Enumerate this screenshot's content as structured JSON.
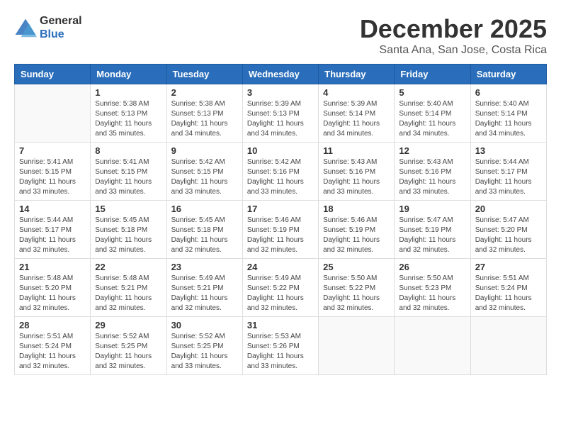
{
  "logo": {
    "general": "General",
    "blue": "Blue"
  },
  "title": "December 2025",
  "location": "Santa Ana, San Jose, Costa Rica",
  "weekdays": [
    "Sunday",
    "Monday",
    "Tuesday",
    "Wednesday",
    "Thursday",
    "Friday",
    "Saturday"
  ],
  "weeks": [
    [
      {
        "day": "",
        "info": ""
      },
      {
        "day": "1",
        "info": "Sunrise: 5:38 AM\nSunset: 5:13 PM\nDaylight: 11 hours\nand 35 minutes."
      },
      {
        "day": "2",
        "info": "Sunrise: 5:38 AM\nSunset: 5:13 PM\nDaylight: 11 hours\nand 34 minutes."
      },
      {
        "day": "3",
        "info": "Sunrise: 5:39 AM\nSunset: 5:13 PM\nDaylight: 11 hours\nand 34 minutes."
      },
      {
        "day": "4",
        "info": "Sunrise: 5:39 AM\nSunset: 5:14 PM\nDaylight: 11 hours\nand 34 minutes."
      },
      {
        "day": "5",
        "info": "Sunrise: 5:40 AM\nSunset: 5:14 PM\nDaylight: 11 hours\nand 34 minutes."
      },
      {
        "day": "6",
        "info": "Sunrise: 5:40 AM\nSunset: 5:14 PM\nDaylight: 11 hours\nand 34 minutes."
      }
    ],
    [
      {
        "day": "7",
        "info": "Sunrise: 5:41 AM\nSunset: 5:15 PM\nDaylight: 11 hours\nand 33 minutes."
      },
      {
        "day": "8",
        "info": "Sunrise: 5:41 AM\nSunset: 5:15 PM\nDaylight: 11 hours\nand 33 minutes."
      },
      {
        "day": "9",
        "info": "Sunrise: 5:42 AM\nSunset: 5:15 PM\nDaylight: 11 hours\nand 33 minutes."
      },
      {
        "day": "10",
        "info": "Sunrise: 5:42 AM\nSunset: 5:16 PM\nDaylight: 11 hours\nand 33 minutes."
      },
      {
        "day": "11",
        "info": "Sunrise: 5:43 AM\nSunset: 5:16 PM\nDaylight: 11 hours\nand 33 minutes."
      },
      {
        "day": "12",
        "info": "Sunrise: 5:43 AM\nSunset: 5:16 PM\nDaylight: 11 hours\nand 33 minutes."
      },
      {
        "day": "13",
        "info": "Sunrise: 5:44 AM\nSunset: 5:17 PM\nDaylight: 11 hours\nand 33 minutes."
      }
    ],
    [
      {
        "day": "14",
        "info": "Sunrise: 5:44 AM\nSunset: 5:17 PM\nDaylight: 11 hours\nand 32 minutes."
      },
      {
        "day": "15",
        "info": "Sunrise: 5:45 AM\nSunset: 5:18 PM\nDaylight: 11 hours\nand 32 minutes."
      },
      {
        "day": "16",
        "info": "Sunrise: 5:45 AM\nSunset: 5:18 PM\nDaylight: 11 hours\nand 32 minutes."
      },
      {
        "day": "17",
        "info": "Sunrise: 5:46 AM\nSunset: 5:19 PM\nDaylight: 11 hours\nand 32 minutes."
      },
      {
        "day": "18",
        "info": "Sunrise: 5:46 AM\nSunset: 5:19 PM\nDaylight: 11 hours\nand 32 minutes."
      },
      {
        "day": "19",
        "info": "Sunrise: 5:47 AM\nSunset: 5:19 PM\nDaylight: 11 hours\nand 32 minutes."
      },
      {
        "day": "20",
        "info": "Sunrise: 5:47 AM\nSunset: 5:20 PM\nDaylight: 11 hours\nand 32 minutes."
      }
    ],
    [
      {
        "day": "21",
        "info": "Sunrise: 5:48 AM\nSunset: 5:20 PM\nDaylight: 11 hours\nand 32 minutes."
      },
      {
        "day": "22",
        "info": "Sunrise: 5:48 AM\nSunset: 5:21 PM\nDaylight: 11 hours\nand 32 minutes."
      },
      {
        "day": "23",
        "info": "Sunrise: 5:49 AM\nSunset: 5:21 PM\nDaylight: 11 hours\nand 32 minutes."
      },
      {
        "day": "24",
        "info": "Sunrise: 5:49 AM\nSunset: 5:22 PM\nDaylight: 11 hours\nand 32 minutes."
      },
      {
        "day": "25",
        "info": "Sunrise: 5:50 AM\nSunset: 5:22 PM\nDaylight: 11 hours\nand 32 minutes."
      },
      {
        "day": "26",
        "info": "Sunrise: 5:50 AM\nSunset: 5:23 PM\nDaylight: 11 hours\nand 32 minutes."
      },
      {
        "day": "27",
        "info": "Sunrise: 5:51 AM\nSunset: 5:24 PM\nDaylight: 11 hours\nand 32 minutes."
      }
    ],
    [
      {
        "day": "28",
        "info": "Sunrise: 5:51 AM\nSunset: 5:24 PM\nDaylight: 11 hours\nand 32 minutes."
      },
      {
        "day": "29",
        "info": "Sunrise: 5:52 AM\nSunset: 5:25 PM\nDaylight: 11 hours\nand 32 minutes."
      },
      {
        "day": "30",
        "info": "Sunrise: 5:52 AM\nSunset: 5:25 PM\nDaylight: 11 hours\nand 33 minutes."
      },
      {
        "day": "31",
        "info": "Sunrise: 5:53 AM\nSunset: 5:26 PM\nDaylight: 11 hours\nand 33 minutes."
      },
      {
        "day": "",
        "info": ""
      },
      {
        "day": "",
        "info": ""
      },
      {
        "day": "",
        "info": ""
      }
    ]
  ]
}
